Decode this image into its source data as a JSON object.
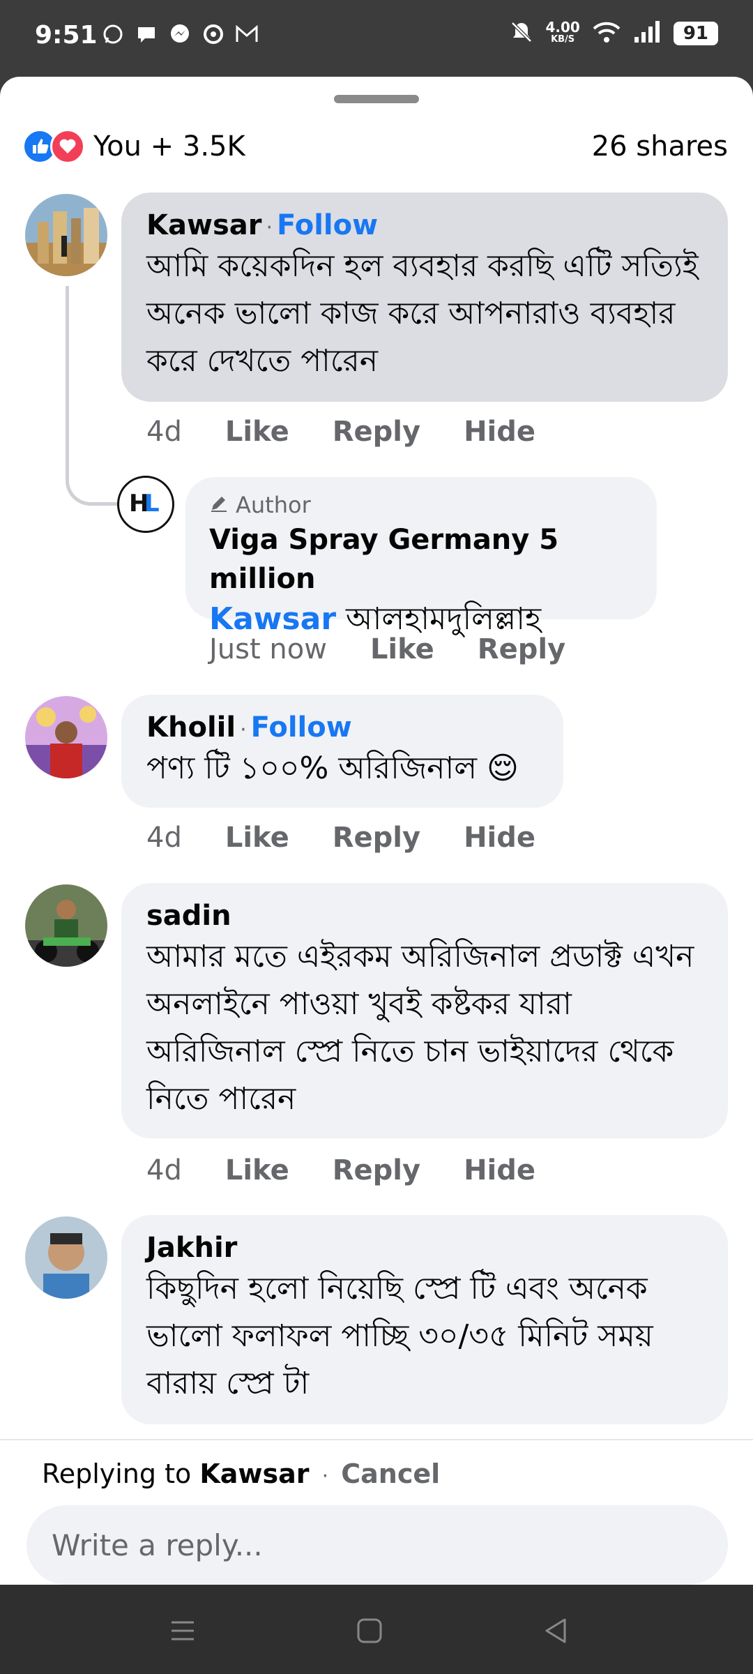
{
  "status": {
    "time": "9:51",
    "net_speed": "4.00",
    "net_unit": "KB/S",
    "battery": "91",
    "notification_icons": [
      "whatsapp-icon",
      "chat-icon",
      "messenger-icon",
      "vpn-icon",
      "gmail-icon"
    ]
  },
  "reactions": {
    "summary": "You + 3.5K",
    "shares": "26 shares"
  },
  "comments": [
    {
      "name": "Kawsar",
      "follow": "Follow",
      "text": "আমি কয়েকদিন হল ব্যবহার করছি এটি সত্যিই অনেক ভালো কাজ করে আপনারাও ব্যবহার করে দেখতে পারেন",
      "time": "4d",
      "like": "Like",
      "reply": "Reply",
      "hide": "Hide"
    },
    {
      "name": "Kholil",
      "follow": "Follow",
      "text": "পণ্য টি ১০০% অরিজিনাল 😌",
      "time": "4d",
      "like": "Like",
      "reply": "Reply",
      "hide": "Hide"
    },
    {
      "name": "sadin",
      "text": "আমার মতে এইরকম অরিজিনাল প্রডাক্ট এখন অনলাইনে পাওয়া খুবই কষ্টকর যারা অরিজিনাল স্প্রে নিতে চান ভাইয়াদের থেকে নিতে পারেন",
      "time": "4d",
      "like": "Like",
      "reply": "Reply",
      "hide": "Hide"
    },
    {
      "name": "Jakhir",
      "text": "কিছুদিন হলো নিয়েছি স্প্রে টি এবং অনেক ভালো ফলাফল পাচ্ছি ৩০/৩৫ মিনিট সময় বারায় স্প্রে টা"
    }
  ],
  "author_reply": {
    "tag": "Author",
    "name": "Viga Spray Germany 5 million",
    "mention": "Kawsar",
    "text": "আলহামদুলিল্লাহ",
    "time": "Just now",
    "like": "Like",
    "reply": "Reply"
  },
  "reply_box": {
    "replying_prefix": "Replying to",
    "replying_name": "Kawsar",
    "cancel": "Cancel",
    "placeholder": "Write a reply..."
  },
  "colors": {
    "accent": "#1877f2",
    "love": "#f33e58",
    "bubble": "#f0f2f5",
    "bubble_highlight": "#dcdde3",
    "secondary_text": "#65676b"
  }
}
